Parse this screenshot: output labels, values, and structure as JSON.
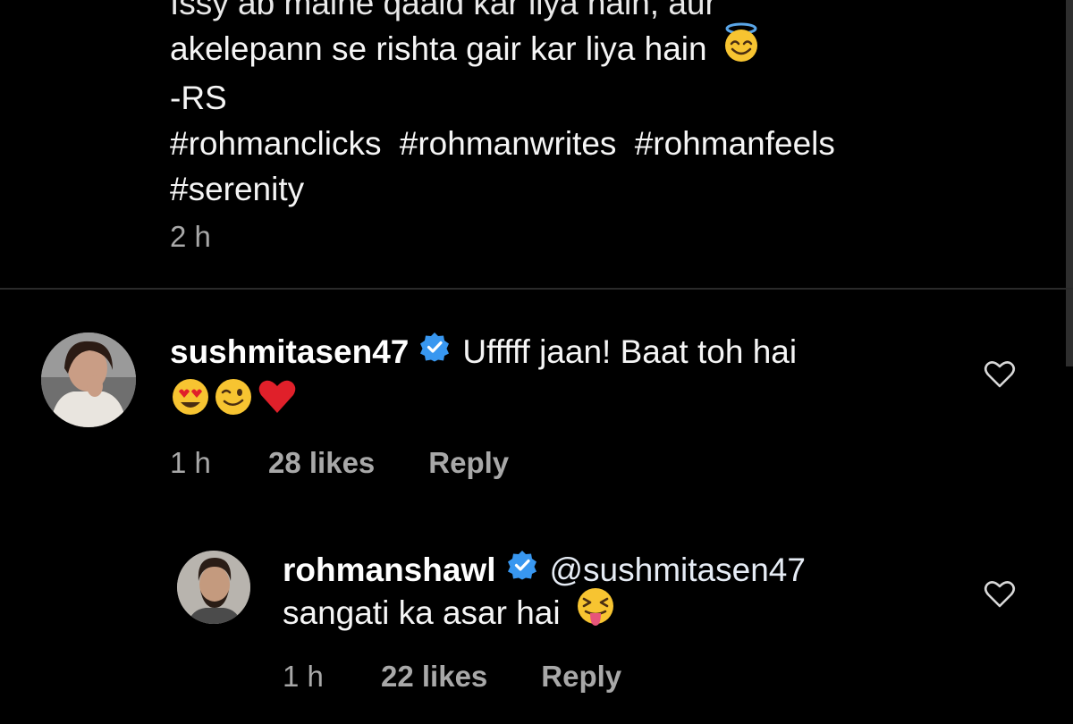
{
  "post": {
    "caption_lines": [
      "Issy ab maine qaaid kar liya hain, aur",
      "akelepann se rishta gair kar liya hain",
      "-RS"
    ],
    "caption_emoji": "smiling-face-with-halo",
    "hashtags": [
      "#rohmanclicks",
      "#rohmanwrites",
      "#rohmanfeels",
      "#serenity"
    ],
    "time": "2 h"
  },
  "comments": [
    {
      "username": "sushmitasen47",
      "verified": true,
      "text": "Ufffff jaan! Baat toh hai",
      "emojis": [
        "heart-eyes-emoji",
        "winking-face-emoji",
        "red-heart-emoji"
      ],
      "time": "1 h",
      "likes": "28 likes",
      "reply_label": "Reply"
    },
    {
      "username": "rohmanshawl",
      "verified": true,
      "mention": "@sushmitasen47",
      "text": "sangati ka asar hai",
      "emojis": [
        "tongue-out-squinting-emoji"
      ],
      "time": "1 h",
      "likes": "22 likes",
      "reply_label": "Reply"
    }
  ],
  "colors": {
    "background": "#000000",
    "primary_text": "#f5f5f5",
    "secondary_text": "#a8a8a8",
    "verified_blue": "#3897f0",
    "divider": "#2a2a2a",
    "heart_red": "#e0202a",
    "emoji_yellow": "#f7c431"
  }
}
